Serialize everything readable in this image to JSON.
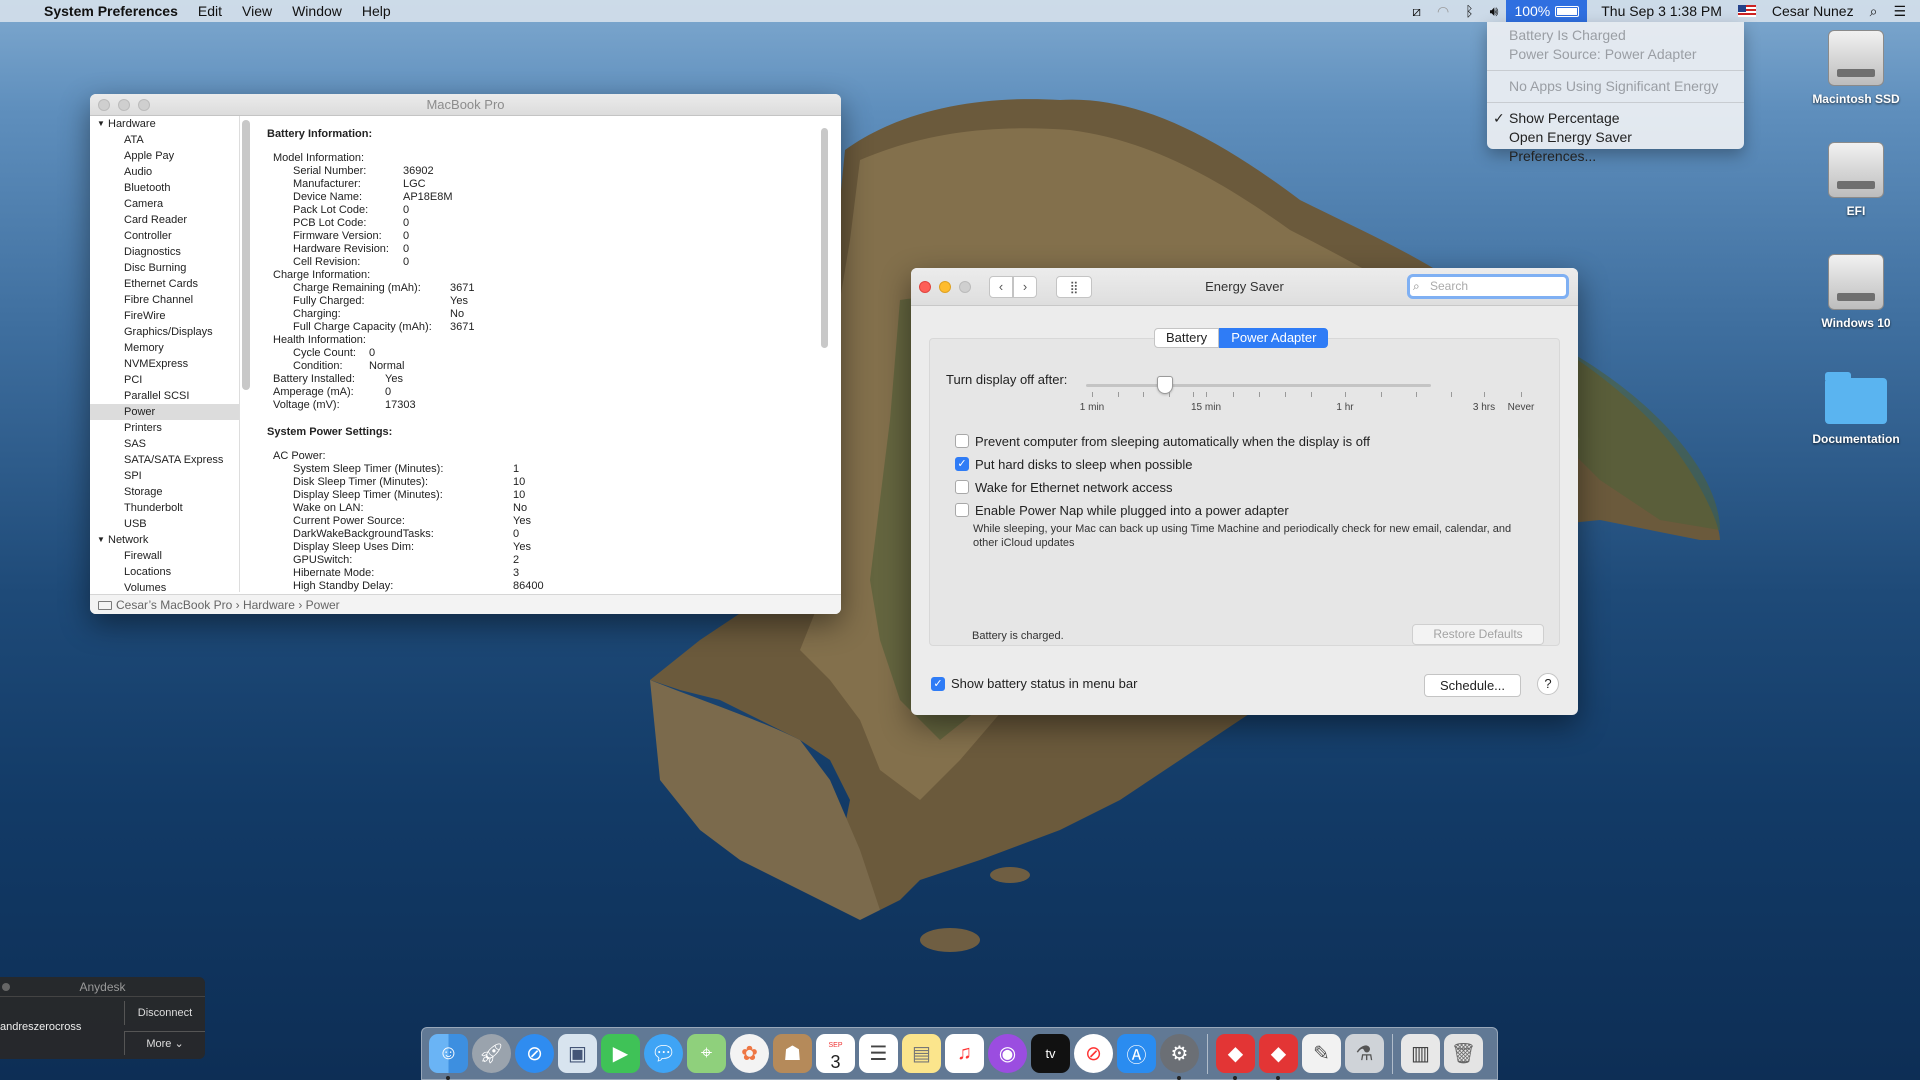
{
  "menubar": {
    "apple": "",
    "app_name": "System Preferences",
    "menus": [
      "Edit",
      "View",
      "Window",
      "Help"
    ],
    "battery_percent": "100%",
    "datetime": "Thu Sep 3  1:38 PM",
    "user": "Cesar Nunez"
  },
  "battery_menu": {
    "status": "Battery Is Charged",
    "source": "Power Source: Power Adapter",
    "apps": "No Apps Using Significant Energy",
    "show_percentage": "Show Percentage",
    "open_prefs": "Open Energy Saver Preferences..."
  },
  "desktop": {
    "icons": [
      "Macintosh SSD",
      "EFI",
      "Windows 10",
      "Documentation"
    ]
  },
  "sysinfo": {
    "title": "MacBook Pro",
    "sidebar": {
      "hardware": "Hardware",
      "hardware_items": [
        "ATA",
        "Apple Pay",
        "Audio",
        "Bluetooth",
        "Camera",
        "Card Reader",
        "Controller",
        "Diagnostics",
        "Disc Burning",
        "Ethernet Cards",
        "Fibre Channel",
        "FireWire",
        "Graphics/Displays",
        "Memory",
        "NVMExpress",
        "PCI",
        "Parallel SCSI",
        "Power",
        "Printers",
        "SAS",
        "SATA/SATA Express",
        "SPI",
        "Storage",
        "Thunderbolt",
        "USB"
      ],
      "selected": "Power",
      "network": "Network",
      "network_items": [
        "Firewall",
        "Locations",
        "Volumes"
      ]
    },
    "battery_header": "Battery Information:",
    "model_info": "Model Information:",
    "serial_k": "Serial Number:",
    "serial_v": "36902",
    "manu_k": "Manufacturer:",
    "manu_v": "LGC",
    "devname_k": "Device Name:",
    "devname_v": "AP18E8M",
    "pack_k": "Pack Lot Code:",
    "pack_v": "0",
    "pcb_k": "PCB Lot Code:",
    "pcb_v": "0",
    "fw_k": "Firmware Version:",
    "fw_v": "0",
    "hw_k": "Hardware Revision:",
    "hw_v": "0",
    "cell_k": "Cell Revision:",
    "cell_v": "0",
    "charge_info": "Charge Information:",
    "remain_k": "Charge Remaining (mAh):",
    "remain_v": "3671",
    "full_k": "Fully Charged:",
    "full_v": "Yes",
    "charging_k": "Charging:",
    "charging_v": "No",
    "fullcap_k": "Full Charge Capacity (mAh):",
    "fullcap_v": "3671",
    "health_info": "Health Information:",
    "cycle_k": "Cycle Count:",
    "cycle_v": "0",
    "cond_k": "Condition:",
    "cond_v": "Normal",
    "installed_k": "Battery Installed:",
    "installed_v": "Yes",
    "amp_k": "Amperage (mA):",
    "amp_v": "0",
    "volt_k": "Voltage (mV):",
    "volt_v": "17303",
    "power_header": "System Power Settings:",
    "ac_power": "AC Power:",
    "sst_k": "System Sleep Timer (Minutes):",
    "sst_v": "1",
    "dst_k": "Disk Sleep Timer (Minutes):",
    "dst_v": "10",
    "dspt_k": "Display Sleep Timer (Minutes):",
    "dspt_v": "10",
    "wol_k": "Wake on LAN:",
    "wol_v": "No",
    "cps_k": "Current Power Source:",
    "cps_v": "Yes",
    "dwbt_k": "DarkWakeBackgroundTasks:",
    "dwbt_v": "0",
    "dsud_k": "Display Sleep Uses Dim:",
    "dsud_v": "Yes",
    "gpu_k": "GPUSwitch:",
    "gpu_v": "2",
    "hib_k": "Hibernate Mode:",
    "hib_v": "3",
    "hsd_k": "High Standby Delay:",
    "hsd_v": "86400",
    "path": [
      "Cesar’s MacBook Pro",
      "Hardware",
      "Power"
    ]
  },
  "energy": {
    "title": "Energy Saver",
    "search_placeholder": "Search",
    "tabs": [
      "Battery",
      "Power Adapter"
    ],
    "active_tab": "Power Adapter",
    "slider_label": "Turn display off after:",
    "slider_ticks": [
      "1 min",
      "15 min",
      "1 hr",
      "3 hrs",
      "Never"
    ],
    "slider_value_minutes": 10,
    "options": [
      {
        "label": "Prevent computer from sleeping automatically when the display is off",
        "checked": false
      },
      {
        "label": "Put hard disks to sleep when possible",
        "checked": true
      },
      {
        "label": "Wake for Ethernet network access",
        "checked": false
      },
      {
        "label": "Enable Power Nap while plugged into a power adapter",
        "checked": false
      }
    ],
    "powernap_note": "While sleeping, your Mac can back up using Time Machine and periodically check for new email, calendar, and other iCloud updates",
    "status": "Battery is charged.",
    "restore": "Restore Defaults",
    "show_battery": "Show battery status in menu bar",
    "schedule": "Schedule...",
    "help": "?"
  },
  "anydesk": {
    "title": "Anydesk",
    "user": "andreszerocross",
    "disconnect": "Disconnect",
    "more": "More"
  },
  "dock": {
    "icons": [
      "finder",
      "launchpad",
      "safari",
      "preview",
      "facetime",
      "messages",
      "maps",
      "photos",
      "contacts",
      "calendar",
      "reminders",
      "notes",
      "music",
      "podcasts",
      "tv",
      "news",
      "app-store",
      "system-preferences",
      "anydesk",
      "anydesk-2",
      "text-edit",
      "utility",
      "documents",
      "trash"
    ],
    "calendar_month": "SEP",
    "calendar_day": "3",
    "tv_label": "tv"
  }
}
